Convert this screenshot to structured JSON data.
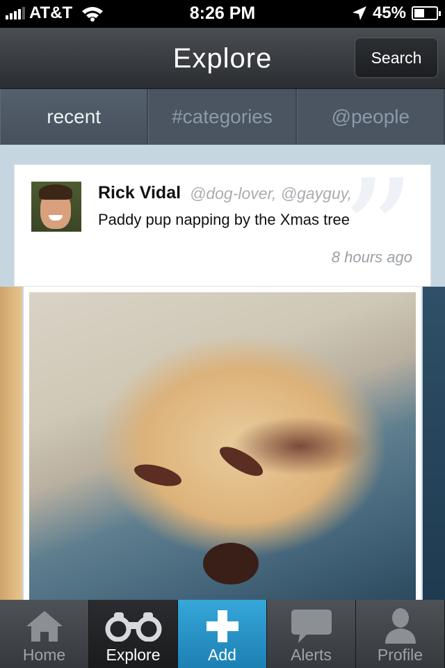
{
  "status_bar": {
    "carrier": "AT&T",
    "time": "8:26 PM",
    "battery": "45%",
    "battery_level": 0.45,
    "icons": [
      "signal-icon",
      "wifi-icon",
      "location-arrow-icon",
      "battery-icon"
    ]
  },
  "nav": {
    "title": "Explore",
    "search_label": "Search"
  },
  "segments": [
    {
      "label": "recent",
      "active": true
    },
    {
      "label": "#categories",
      "active": false
    },
    {
      "label": "@people",
      "active": false
    }
  ],
  "post": {
    "author": "Rick Vidal",
    "tags": "@dog-lover, @gayguy,",
    "caption": "Paddy pup napping by the Xmas tree",
    "time": "8 hours ago",
    "decoration": "quote-icon"
  },
  "tabs": [
    {
      "label": "Home",
      "icon": "home-icon",
      "active": false
    },
    {
      "label": "Explore",
      "icon": "binoculars-icon",
      "active": true
    },
    {
      "label": "Add",
      "icon": "plus-icon",
      "active": false
    },
    {
      "label": "Alerts",
      "icon": "speech-bubble-icon",
      "active": false
    },
    {
      "label": "Profile",
      "icon": "person-icon",
      "active": false
    }
  ],
  "colors": {
    "nav_bar": "#2f3236",
    "add_tab": "#2a92c6",
    "content_bg": "#c6d6e1"
  }
}
